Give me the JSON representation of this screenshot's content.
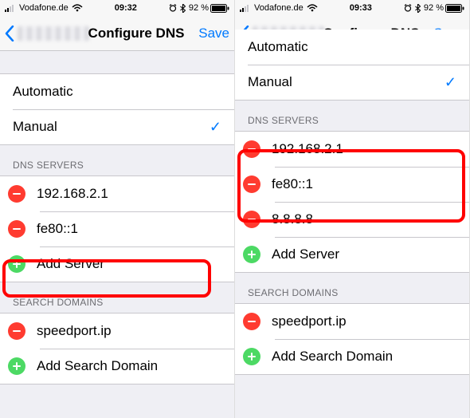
{
  "left": {
    "status": {
      "carrier": "Vodafone.de",
      "time": "09:32",
      "battery_pct": "92 %"
    },
    "nav": {
      "title": "Configure DNS",
      "save": "Save"
    },
    "mode": {
      "automatic": "Automatic",
      "manual": "Manual",
      "selected": "manual"
    },
    "dns_header": "DNS SERVERS",
    "dns_servers": [
      {
        "ip": "192.168.2.1",
        "action": "remove"
      },
      {
        "ip": "fe80::1",
        "action": "remove"
      }
    ],
    "add_server": "Add Server",
    "search_header": "SEARCH DOMAINS",
    "search_domains": [
      {
        "domain": "speedport.ip",
        "action": "remove"
      }
    ],
    "add_search": "Add Search Domain"
  },
  "right": {
    "status": {
      "carrier": "Vodafone.de",
      "time": "09:33",
      "battery_pct": "92 %"
    },
    "nav": {
      "title": "Configure DNS",
      "save": "Save"
    },
    "mode": {
      "automatic": "Automatic",
      "manual": "Manual",
      "selected": "manual"
    },
    "dns_header": "DNS SERVERS",
    "dns_servers": [
      {
        "ip": "192.168.2.1",
        "action": "remove"
      },
      {
        "ip": "fe80::1",
        "action": "remove"
      },
      {
        "ip": "8.8.8.8",
        "action": "remove"
      }
    ],
    "add_server": "Add Server",
    "search_header": "SEARCH DOMAINS",
    "search_domains": [
      {
        "domain": "speedport.ip",
        "action": "remove"
      }
    ],
    "add_search": "Add Search Domain"
  }
}
